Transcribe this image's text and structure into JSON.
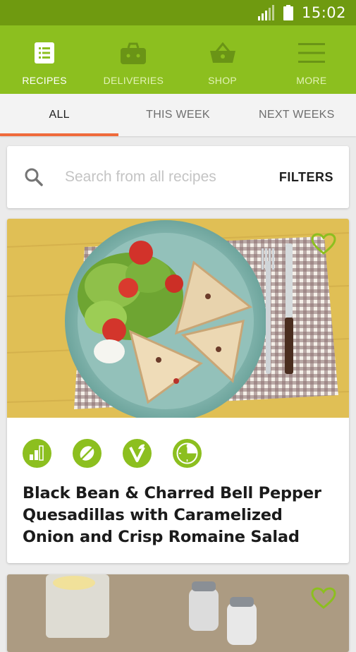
{
  "status_bar": {
    "time": "15:02"
  },
  "nav": {
    "items": [
      {
        "label": "RECIPES",
        "icon": "recipes-list-icon"
      },
      {
        "label": "DELIVERIES",
        "icon": "delivery-box-icon"
      },
      {
        "label": "SHOP",
        "icon": "basket-icon"
      },
      {
        "label": "MORE",
        "icon": "menu-icon"
      }
    ]
  },
  "tabs": [
    "ALL",
    "THIS WEEK",
    "NEXT WEEKS"
  ],
  "active_tab": "ALL",
  "search": {
    "placeholder": "Search from all recipes",
    "filters_label": "FILTERS"
  },
  "recipes": [
    {
      "title": "Black Bean & Charred Bell Pepper Quesadillas with Caramelized Onion and Crisp Romaine Salad",
      "badges": [
        "difficulty-icon",
        "no-dairy-icon",
        "vegetarian-icon",
        "time-icon"
      ],
      "favorite": false
    }
  ],
  "colors": {
    "status_bar": "#6f9a10",
    "brand_green": "#8cbf1f",
    "accent_orange": "#ef6a3b",
    "badge_green": "#8cbf1f"
  }
}
